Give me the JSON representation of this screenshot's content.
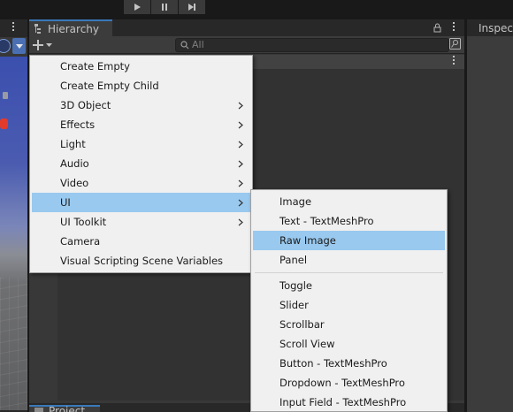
{
  "toolbar": {
    "buttons": [
      {
        "icon": "play-icon"
      },
      {
        "icon": "pause-icon"
      },
      {
        "icon": "step-icon"
      }
    ]
  },
  "hierarchy": {
    "tab_label": "Hierarchy",
    "search_placeholder": "All"
  },
  "inspector": {
    "tab_label": "Inspector"
  },
  "bottom": {
    "project_tab_label": "Project"
  },
  "create_menu": {
    "items": [
      {
        "label": "Create Empty",
        "submenu": false,
        "highlighted": false
      },
      {
        "label": "Create Empty Child",
        "submenu": false,
        "highlighted": false
      },
      {
        "label": "3D Object",
        "submenu": true,
        "highlighted": false
      },
      {
        "label": "Effects",
        "submenu": true,
        "highlighted": false
      },
      {
        "label": "Light",
        "submenu": true,
        "highlighted": false
      },
      {
        "label": "Audio",
        "submenu": true,
        "highlighted": false
      },
      {
        "label": "Video",
        "submenu": true,
        "highlighted": false
      },
      {
        "label": "UI",
        "submenu": true,
        "highlighted": true
      },
      {
        "label": "UI Toolkit",
        "submenu": true,
        "highlighted": false
      },
      {
        "label": "Camera",
        "submenu": false,
        "highlighted": false
      },
      {
        "label": "Visual Scripting Scene Variables",
        "submenu": false,
        "highlighted": false
      }
    ]
  },
  "ui_submenu": {
    "group1": [
      "Image",
      "Text - TextMeshPro",
      "Raw Image",
      "Panel"
    ],
    "highlighted": "Raw Image",
    "group2": [
      "Toggle",
      "Slider",
      "Scrollbar",
      "Scroll View",
      "Button - TextMeshPro",
      "Dropdown - TextMeshPro",
      "Input Field - TextMeshPro"
    ]
  },
  "colors": {
    "menu_highlight": "#99c9ef",
    "tab_accent": "#3a79bb",
    "panel_bg": "#383838",
    "menu_bg": "#f0f0f0"
  }
}
